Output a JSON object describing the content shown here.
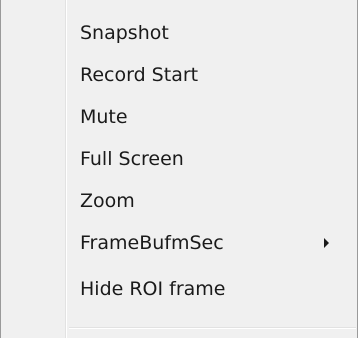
{
  "context_menu": {
    "items": [
      {
        "label": "Snapshot"
      },
      {
        "label": "Record Start"
      },
      {
        "label": "Mute"
      },
      {
        "label": "Full Screen"
      },
      {
        "label": "Zoom"
      },
      {
        "label": "FrameBufmSec",
        "has_submenu": true,
        "submenu_icon": "chevron-right-icon"
      },
      {
        "label": "Hide ROI frame"
      }
    ],
    "colors": {
      "background": "#f0f0f0",
      "text": "#1a1a1a",
      "border": "#9a9a9a",
      "separator": "#e2e2e2"
    }
  }
}
